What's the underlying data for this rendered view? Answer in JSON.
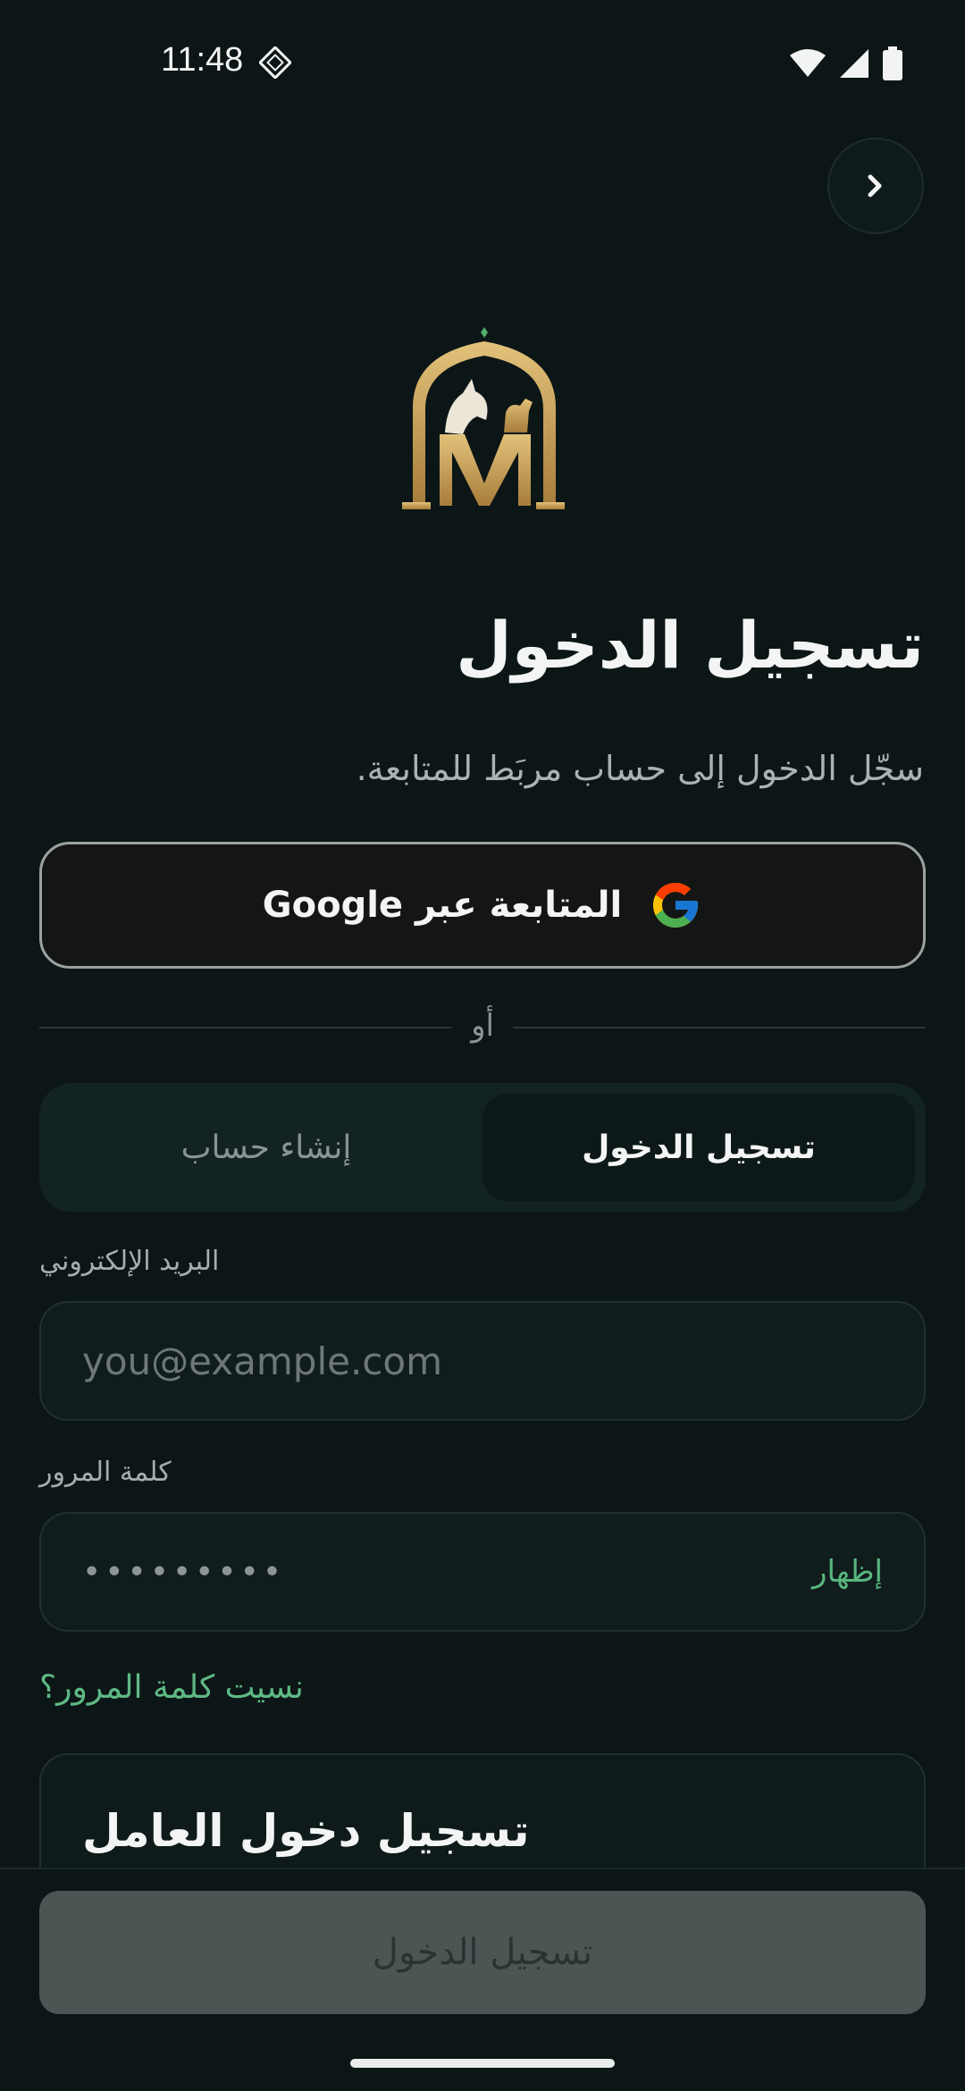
{
  "status_bar": {
    "time": "11:48"
  },
  "header": {
    "back_icon": "chevron-right-icon"
  },
  "logo": {
    "name": "arch-horse-camel-logo"
  },
  "page": {
    "title": "تسجيل الدخول",
    "subtitle": "سجّل الدخول إلى حساب مربَط للمتابعة."
  },
  "google_button": {
    "label": "المتابعة عبر Google",
    "icon": "google-icon"
  },
  "divider": {
    "label": "أو"
  },
  "tabs": {
    "login": "تسجيل الدخول",
    "signup": "إنشاء حساب"
  },
  "email": {
    "label": "البريد الإلكتروني",
    "placeholder": "you@example.com"
  },
  "password": {
    "label": "كلمة المرور",
    "value": "•••••••••",
    "show_label": "إظهار"
  },
  "forgot_password": "نسيت كلمة المرور؟",
  "worker_login": {
    "title": "تسجيل دخول العامل"
  },
  "submit": {
    "label": "تسجيل الدخول"
  },
  "colors": {
    "accent": "#58b67e",
    "background": "#0c1616",
    "gold": "#c9a45a"
  }
}
